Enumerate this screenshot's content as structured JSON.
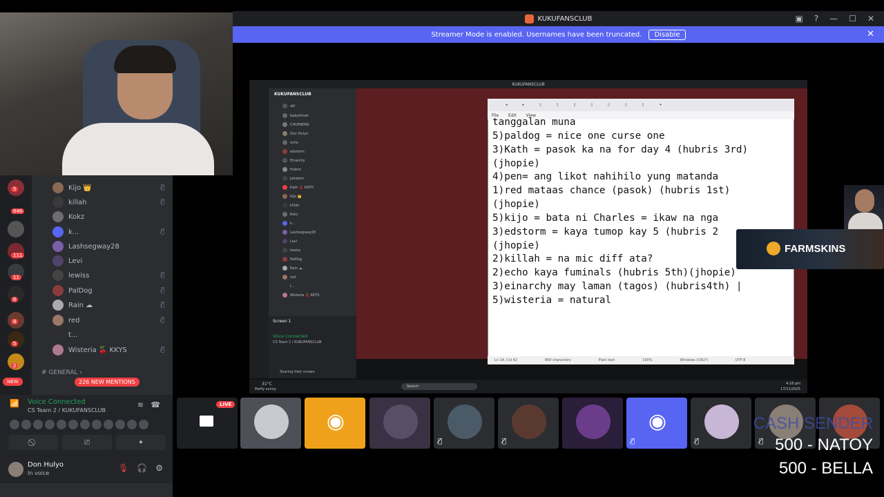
{
  "window": {
    "title": "KUKUFANSCLUB"
  },
  "banner": {
    "text": "Streamer Mode is enabled. Usernames have been truncated.",
    "button": "Disable"
  },
  "guild_badges": [
    "5",
    "846",
    "111",
    "11",
    "6",
    "8",
    "5",
    "2"
  ],
  "new_badge": "NEW",
  "members": [
    {
      "name": "Kijo 👑",
      "color": "#8a6a52"
    },
    {
      "name": "killah",
      "color": "#3a3a3a"
    },
    {
      "name": "Kokz",
      "color": "#6d6d6d"
    },
    {
      "name": "k...",
      "color": "#5865f2"
    },
    {
      "name": "Lashsegway28",
      "color": "#7b5ea7"
    },
    {
      "name": "Levi",
      "color": "#50446a"
    },
    {
      "name": "lewiss",
      "color": "#444"
    },
    {
      "name": "PalDog",
      "color": "#8c3c3c"
    },
    {
      "name": "Rain ☁",
      "color": "#aaa"
    },
    {
      "name": "red",
      "color": "#9a7766"
    },
    {
      "name": "t...",
      "color": "#2e2e2e"
    },
    {
      "name": "Wisteria 🍒 KKYS",
      "color": "#b07a8c"
    }
  ],
  "channel": {
    "name": "GENERAL",
    "mentions": "226 NEW MENTIONS"
  },
  "voice": {
    "status": "Voice Connected",
    "location": "CS Team 2 / KUKUFANSCLUB"
  },
  "user": {
    "name": "Don Hulyo",
    "status": "In voice"
  },
  "inner": {
    "server": "KUKUFANSCLUB",
    "members": [
      "akl",
      "babydriver",
      "CHUPAENG",
      "Don Hulyo",
      "echo",
      "edstorm",
      "Einarchy",
      "Hubris",
      "Jahelem",
      "Kath 🍒 KATH",
      "Kijo 👑",
      "killah",
      "Kokz",
      "k...",
      "Lashsegway28",
      "Levi",
      "lewiss",
      "PalDog",
      "Rain ☁",
      "red",
      "t...",
      "Wisteria 🍒 KKYS"
    ],
    "screen": "Screen 1",
    "voice": "Voice Connected",
    "voice_sub": "CS Team 2 / KUKUFANSCLUB",
    "sharing": "Sharing their screen",
    "search": "Search",
    "weather": "31°C",
    "weather_sub": "Partly sunny",
    "time": "4:18 pm",
    "date": "17/11/2025"
  },
  "notepad": {
    "menu": [
      "File",
      "Edit",
      "View"
    ],
    "lines": [
      "tanggalan muna",
      "",
      "5)paldog = nice one curse one",
      "3)Kath = pasok ka na for day 4 (hubris 3rd)",
      "(jhopie)",
      "4)pen= ang likot nahihilo yung matanda",
      "1)red mataas chance (pasok) (hubris 1st)",
      "(jhopie)",
      "5)kijo = bata ni Charles = ikaw na nga",
      "3)edstorm = kaya tumop kay 5 (hubris 2",
      "(jhopie)",
      "2)killah = na mic diff ata?",
      "2)echo kaya fuminals (hubris 5th)(jhopie)",
      "3)einarchy may laman (tagos) (hubris4th) |",
      "5)wisteria = natural"
    ],
    "status": [
      "Ln 14, Col 42",
      "800 characters",
      "Plain text",
      "100%",
      "Windows (CRLF)",
      "UTF-8"
    ]
  },
  "sponsor": {
    "name": "FARMSKINS"
  },
  "live_badge": "LIVE",
  "donations": {
    "header": "CASH SENDER",
    "entries": [
      "500 - NATOY",
      "500  - BELLA"
    ]
  }
}
